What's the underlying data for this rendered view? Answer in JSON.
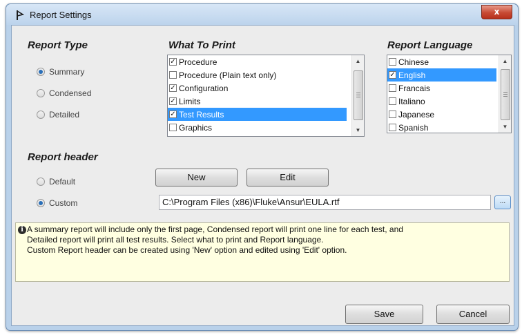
{
  "window": {
    "title": "Report Settings",
    "close_glyph": "x"
  },
  "report_type": {
    "title": "Report Type",
    "options": [
      {
        "label": "Summary",
        "checked": true
      },
      {
        "label": "Condensed",
        "checked": false
      },
      {
        "label": "Detailed",
        "checked": false
      }
    ]
  },
  "what_to_print": {
    "title": "What To Print",
    "items": [
      {
        "label": "Procedure",
        "checked": true,
        "selected": false
      },
      {
        "label": "Procedure (Plain text only)",
        "checked": false,
        "selected": false
      },
      {
        "label": "Configuration",
        "checked": true,
        "selected": false
      },
      {
        "label": "Limits",
        "checked": true,
        "selected": false
      },
      {
        "label": "Test Results",
        "checked": true,
        "selected": true
      },
      {
        "label": "Graphics",
        "checked": false,
        "selected": false
      }
    ]
  },
  "report_language": {
    "title": "Report Language",
    "items": [
      {
        "label": "Chinese",
        "checked": false,
        "selected": false
      },
      {
        "label": "English",
        "checked": true,
        "selected": true
      },
      {
        "label": "Francais",
        "checked": false,
        "selected": false
      },
      {
        "label": "Italiano",
        "checked": false,
        "selected": false
      },
      {
        "label": "Japanese",
        "checked": false,
        "selected": false
      },
      {
        "label": "Spanish",
        "checked": false,
        "selected": false
      }
    ]
  },
  "report_header": {
    "title": "Report header",
    "options": [
      {
        "label": "Default",
        "checked": false
      },
      {
        "label": "Custom",
        "checked": true
      }
    ],
    "new_label": "New",
    "edit_label": "Edit",
    "path_value": "C:\\Program Files (x86)\\Fluke\\Ansur\\EULA.rtf",
    "browse_label": "..."
  },
  "info": {
    "icon": "info-icon",
    "lines": [
      "A summary report will include only the first page, Condensed report will print one line for each test, and",
      "Detailed report will print all test results. Select what to print and Report language.",
      "Custom Report header can be created using 'New' option and edited using 'Edit' option."
    ]
  },
  "footer": {
    "save_label": "Save",
    "cancel_label": "Cancel"
  },
  "colors": {
    "title_bar": "#bcd3ec",
    "selection": "#3399ff",
    "info_background": "#ffffe1",
    "close_button": "#c74a34"
  }
}
